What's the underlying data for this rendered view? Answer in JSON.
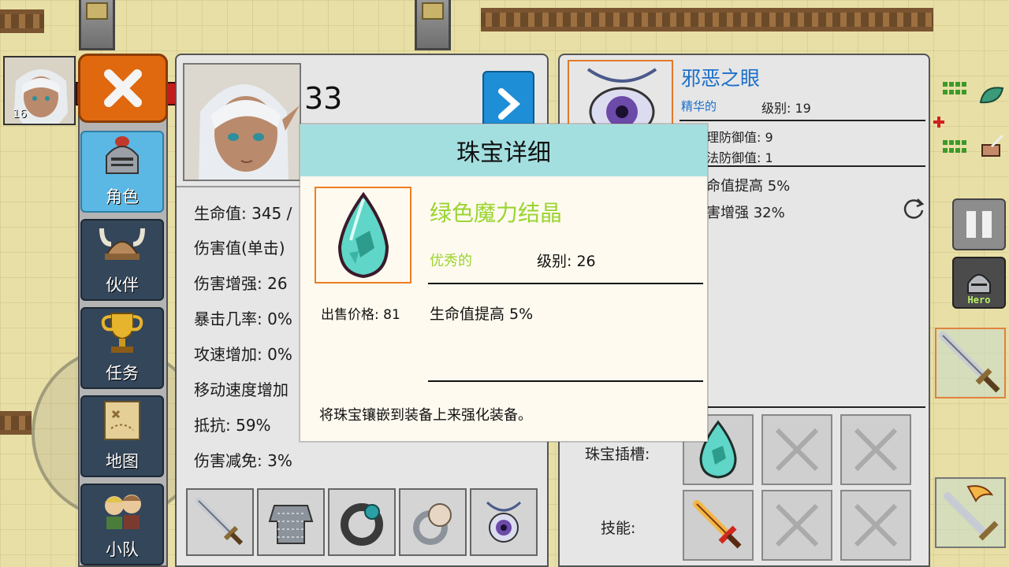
{
  "hero_chip": {
    "level": "16"
  },
  "nav": {
    "items": [
      {
        "label": "角色",
        "icon": "knight-helmet-icon",
        "active": true
      },
      {
        "label": "伙伴",
        "icon": "horned-helmet-icon",
        "active": false
      },
      {
        "label": "任务",
        "icon": "trophy-icon",
        "active": false
      },
      {
        "label": "地图",
        "icon": "map-scroll-icon",
        "active": false
      },
      {
        "label": "小队",
        "icon": "party-icon",
        "active": false
      }
    ]
  },
  "character": {
    "level": "33",
    "stats": [
      "生命值: 345 /",
      "伤害值(单击)",
      "伤害增强: 26",
      "暴击几率: 0%",
      "攻速增加: 0%",
      "移动速度增加",
      "抵抗: 59%",
      "伤害减免: 3%"
    ],
    "equipment": [
      "sword-icon",
      "chainmail-icon",
      "bracelet-icon",
      "ring-icon",
      "amulet-icon"
    ]
  },
  "item_panel": {
    "name": "邪恶之眼",
    "grade": "精华的",
    "level": "级别: 19",
    "base_stats": [
      "理防御值: 9",
      "法防御值: 1"
    ],
    "bonus_stats": [
      "命值提高 5%",
      "害增强 32%"
    ],
    "gem_slot_label": "珠宝插槽:",
    "skill_label": "技能:"
  },
  "modal": {
    "title": "珠宝详细",
    "gem_name": "绿色魔力结晶",
    "grade": "优秀的",
    "level": "级别: 26",
    "sell_price": "出售价格: 81",
    "effect": "生命值提高 5%",
    "description": "将珠宝镶嵌到装备上来强化装备。"
  },
  "hud": {
    "hero_label": "Hero"
  },
  "colors": {
    "gem_name": "#9ad430",
    "modal_header": "#a4dfe0",
    "item_name": "#1a6fc9",
    "nav_active": "#5bb7e3",
    "close_button": "#e0680e"
  }
}
